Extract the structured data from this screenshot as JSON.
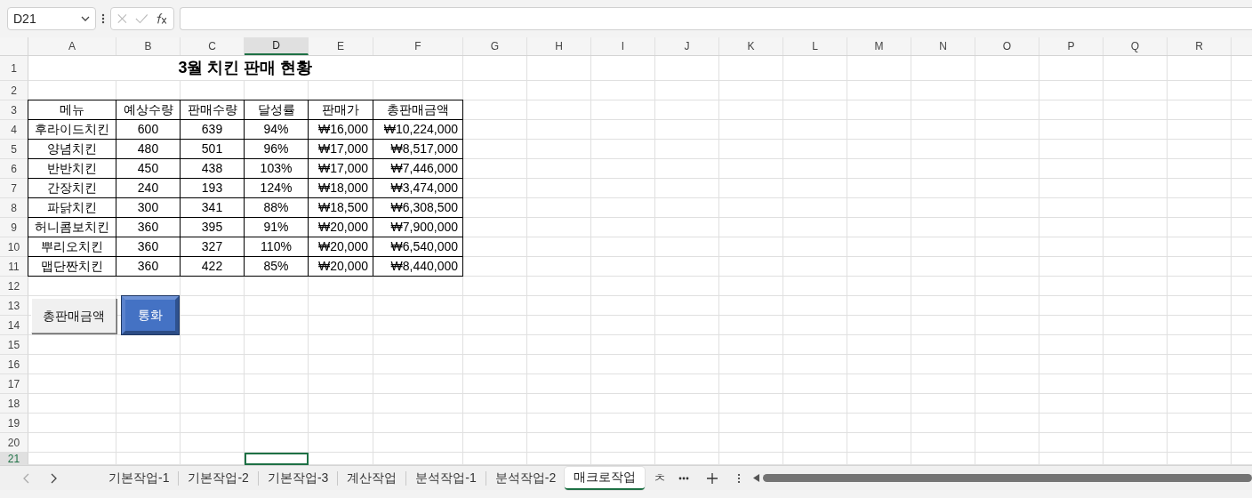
{
  "name_box": "D21",
  "columns": [
    {
      "label": "A",
      "selected": false
    },
    {
      "label": "B",
      "selected": false
    },
    {
      "label": "C",
      "selected": false
    },
    {
      "label": "D",
      "selected": true
    },
    {
      "label": "E",
      "selected": false
    },
    {
      "label": "F",
      "selected": false
    },
    {
      "label": "G",
      "selected": false
    },
    {
      "label": "H",
      "selected": false
    },
    {
      "label": "I",
      "selected": false
    },
    {
      "label": "J",
      "selected": false
    },
    {
      "label": "K",
      "selected": false
    },
    {
      "label": "L",
      "selected": false
    },
    {
      "label": "M",
      "selected": false
    },
    {
      "label": "N",
      "selected": false
    },
    {
      "label": "O",
      "selected": false
    },
    {
      "label": "P",
      "selected": false
    },
    {
      "label": "Q",
      "selected": false
    },
    {
      "label": "R",
      "selected": false
    }
  ],
  "rows": [
    {
      "label": "1",
      "selected": false
    },
    {
      "label": "2",
      "selected": false
    },
    {
      "label": "3",
      "selected": false
    },
    {
      "label": "4",
      "selected": false
    },
    {
      "label": "5",
      "selected": false
    },
    {
      "label": "6",
      "selected": false
    },
    {
      "label": "7",
      "selected": false
    },
    {
      "label": "8",
      "selected": false
    },
    {
      "label": "9",
      "selected": false
    },
    {
      "label": "10",
      "selected": false
    },
    {
      "label": "11",
      "selected": false
    },
    {
      "label": "12",
      "selected": false
    },
    {
      "label": "13",
      "selected": false
    },
    {
      "label": "14",
      "selected": false
    },
    {
      "label": "15",
      "selected": false
    },
    {
      "label": "16",
      "selected": false
    },
    {
      "label": "17",
      "selected": false
    },
    {
      "label": "18",
      "selected": false
    },
    {
      "label": "19",
      "selected": false
    },
    {
      "label": "20",
      "selected": false
    },
    {
      "label": "21",
      "selected": true
    }
  ],
  "title": "3월 치킨 판매 현황",
  "table": {
    "columns": [
      "메뉴",
      "예상수량",
      "판매수량",
      "달성률",
      "판매가",
      "총판매금액"
    ],
    "rows": [
      [
        "후라이드치킨",
        "600",
        "639",
        "94%",
        "₩16,000",
        "₩10,224,000"
      ],
      [
        "양념치킨",
        "480",
        "501",
        "96%",
        "₩17,000",
        "₩8,517,000"
      ],
      [
        "반반치킨",
        "450",
        "438",
        "103%",
        "₩17,000",
        "₩7,446,000"
      ],
      [
        "간장치킨",
        "240",
        "193",
        "124%",
        "₩18,000",
        "₩3,474,000"
      ],
      [
        "파닭치킨",
        "300",
        "341",
        "88%",
        "₩18,500",
        "₩6,308,500"
      ],
      [
        "허니콤보치킨",
        "360",
        "395",
        "91%",
        "₩20,000",
        "₩7,900,000"
      ],
      [
        "뿌리오치킨",
        "360",
        "327",
        "110%",
        "₩20,000",
        "₩6,540,000"
      ],
      [
        "맵단짠치킨",
        "360",
        "422",
        "85%",
        "₩20,000",
        "₩8,440,000"
      ]
    ]
  },
  "buttons": [
    {
      "label": "총판매금액",
      "kind": "plain"
    },
    {
      "label": "통화",
      "kind": "bevel"
    }
  ],
  "sheet_tabs": [
    {
      "label": "기본작업-1",
      "selected": false
    },
    {
      "label": "기본작업-2",
      "selected": false
    },
    {
      "label": "기본작업-3",
      "selected": false
    },
    {
      "label": "계산작업",
      "selected": false
    },
    {
      "label": "분석작업-1",
      "selected": false
    },
    {
      "label": "분석작업-2",
      "selected": false
    },
    {
      "label": "매크로작업",
      "selected": true
    },
    {
      "label": "ㅊ",
      "selected": false
    }
  ]
}
